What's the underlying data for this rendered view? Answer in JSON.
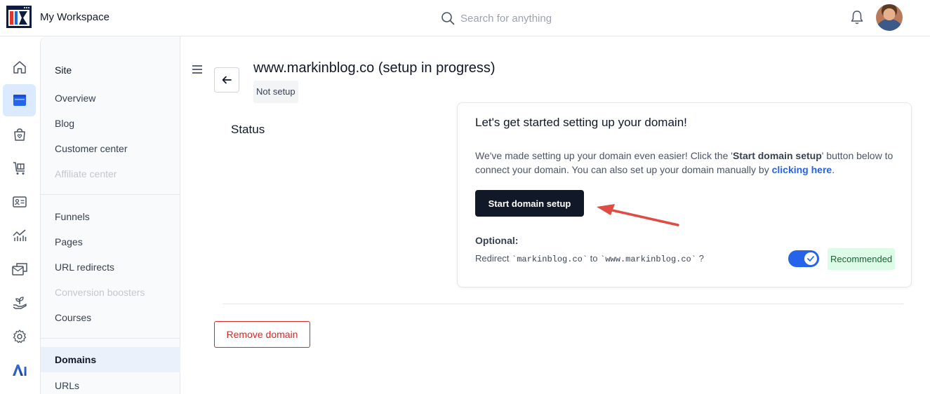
{
  "header": {
    "workspace_name": "My Workspace",
    "search_placeholder": "Search for anything"
  },
  "rail": {
    "items": [
      "home-icon",
      "website-icon",
      "store-icon",
      "cart-icon",
      "contact-card-icon",
      "analytics-icon",
      "mail-icon",
      "growth-icon",
      "settings-icon",
      "ai-icon"
    ],
    "active": "website-icon"
  },
  "subnav": {
    "group_title": "Site",
    "site_items": [
      {
        "label": "Overview"
      },
      {
        "label": "Blog"
      },
      {
        "label": "Customer center"
      },
      {
        "label": "Affiliate center",
        "disabled": true
      }
    ],
    "funnel_items": [
      {
        "label": "Funnels"
      },
      {
        "label": "Pages"
      },
      {
        "label": "URL redirects"
      },
      {
        "label": "Conversion boosters",
        "disabled": true
      },
      {
        "label": "Courses"
      }
    ],
    "bottom_items": [
      {
        "label": "Domains",
        "active": true
      },
      {
        "label": "URLs"
      }
    ]
  },
  "main": {
    "title": "www.markinblog.co (setup in progress)",
    "status_pill": "Not setup",
    "status_heading": "Status",
    "remove_label": "Remove domain"
  },
  "card": {
    "title": "Let's get started setting up your domain!",
    "body_1": "We've made setting up your domain even easier! Click the '",
    "body_bold": "Start domain setup",
    "body_2": "' button below to connect your domain. You can also set up your domain manually by ",
    "body_link": "clicking here",
    "body_end": ".",
    "start_button": "Start domain setup",
    "optional_label": "Optional:",
    "redirect_prefix": "Redirect ",
    "redirect_from": "`markinblog.co`",
    "redirect_to_word": " to ",
    "redirect_to": "`www.markinblog.co`",
    "redirect_suffix": " ?",
    "toggle_on": true,
    "badge": "Recommended"
  },
  "colors": {
    "accent": "#2563eb",
    "dark_button": "#111827",
    "danger": "#dc2626",
    "success_bg": "#dcfce7",
    "annotation_arrow": "#e04b44"
  }
}
